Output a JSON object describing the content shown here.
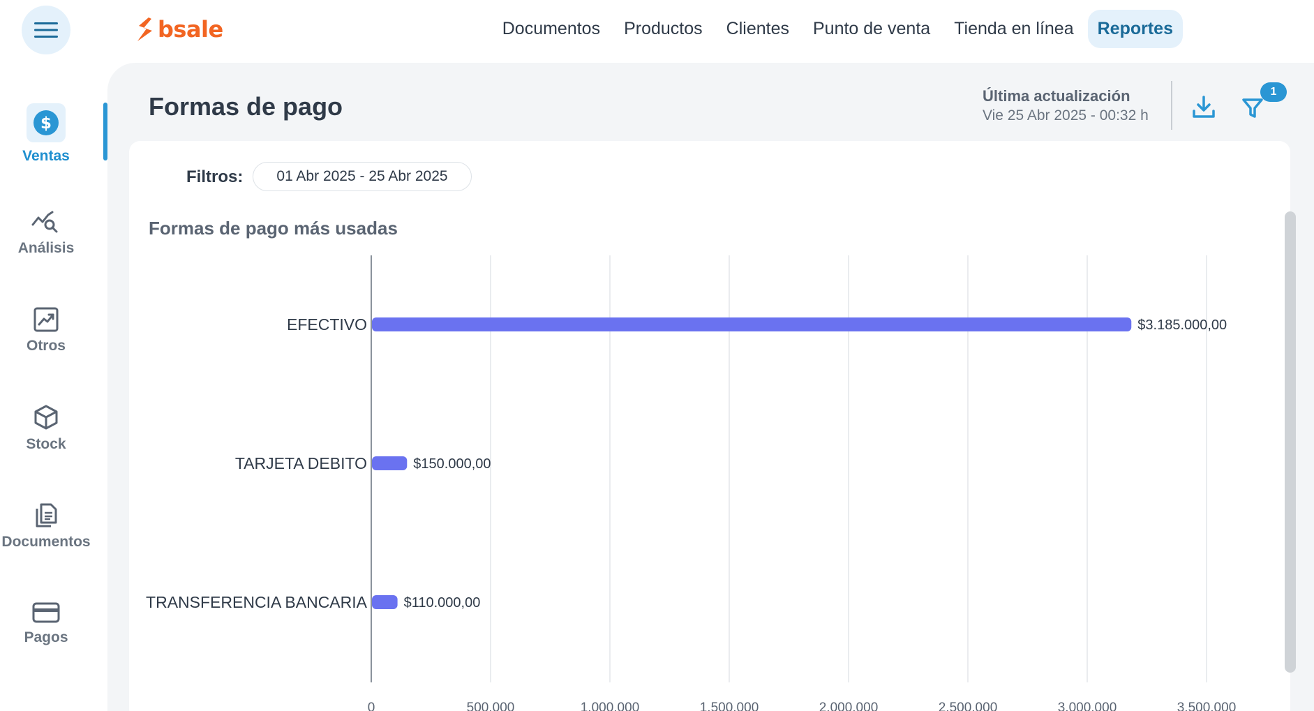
{
  "app": {
    "logo_text": "bsale"
  },
  "colors": {
    "brand": "#f26522",
    "accent": "#2a96d4",
    "bar": "#6a72f0"
  },
  "topnav": {
    "items": [
      {
        "label": "Documentos"
      },
      {
        "label": "Productos"
      },
      {
        "label": "Clientes"
      },
      {
        "label": "Punto de venta"
      },
      {
        "label": "Tienda en línea"
      },
      {
        "label": "Reportes",
        "active": true
      }
    ]
  },
  "sidebar": {
    "items": [
      {
        "label": "Ventas",
        "icon": "dollar-icon",
        "active": true
      },
      {
        "label": "Análisis",
        "icon": "analysis-icon"
      },
      {
        "label": "Otros",
        "icon": "trend-chart-icon"
      },
      {
        "label": "Stock",
        "icon": "box-icon"
      },
      {
        "label": "Documentos",
        "icon": "documents-icon"
      },
      {
        "label": "Pagos",
        "icon": "credit-card-icon"
      }
    ]
  },
  "page": {
    "title": "Formas de pago",
    "update_title": "Última actualización",
    "update_date": "Vie 25 Abr 2025 - 00:32 h",
    "filter_count": "1",
    "filters_label": "Filtros:",
    "date_range": "01 Abr 2025 - 25 Abr 2025",
    "chart_title": "Formas de pago más usadas"
  },
  "chart_data": {
    "type": "bar",
    "orientation": "horizontal",
    "title": "Formas de pago más usadas",
    "categories": [
      "EFECTIVO",
      "TARJETA DEBITO",
      "TRANSFERENCIA BANCARIA"
    ],
    "values": [
      3185000,
      150000,
      110000
    ],
    "value_labels": [
      "$3.185.000,00",
      "$150.000,00",
      "$110.000,00"
    ],
    "xlim": [
      0,
      3500000
    ],
    "xticks": [
      0,
      500000,
      1000000,
      1500000,
      2000000,
      2500000,
      3000000,
      3500000
    ],
    "xtick_labels": [
      "0",
      "500,000",
      "1,000,000",
      "1,500,000",
      "2,000,000",
      "2,500,000",
      "3,000,000",
      "3,500,000"
    ],
    "grid": true,
    "legend": "none"
  }
}
